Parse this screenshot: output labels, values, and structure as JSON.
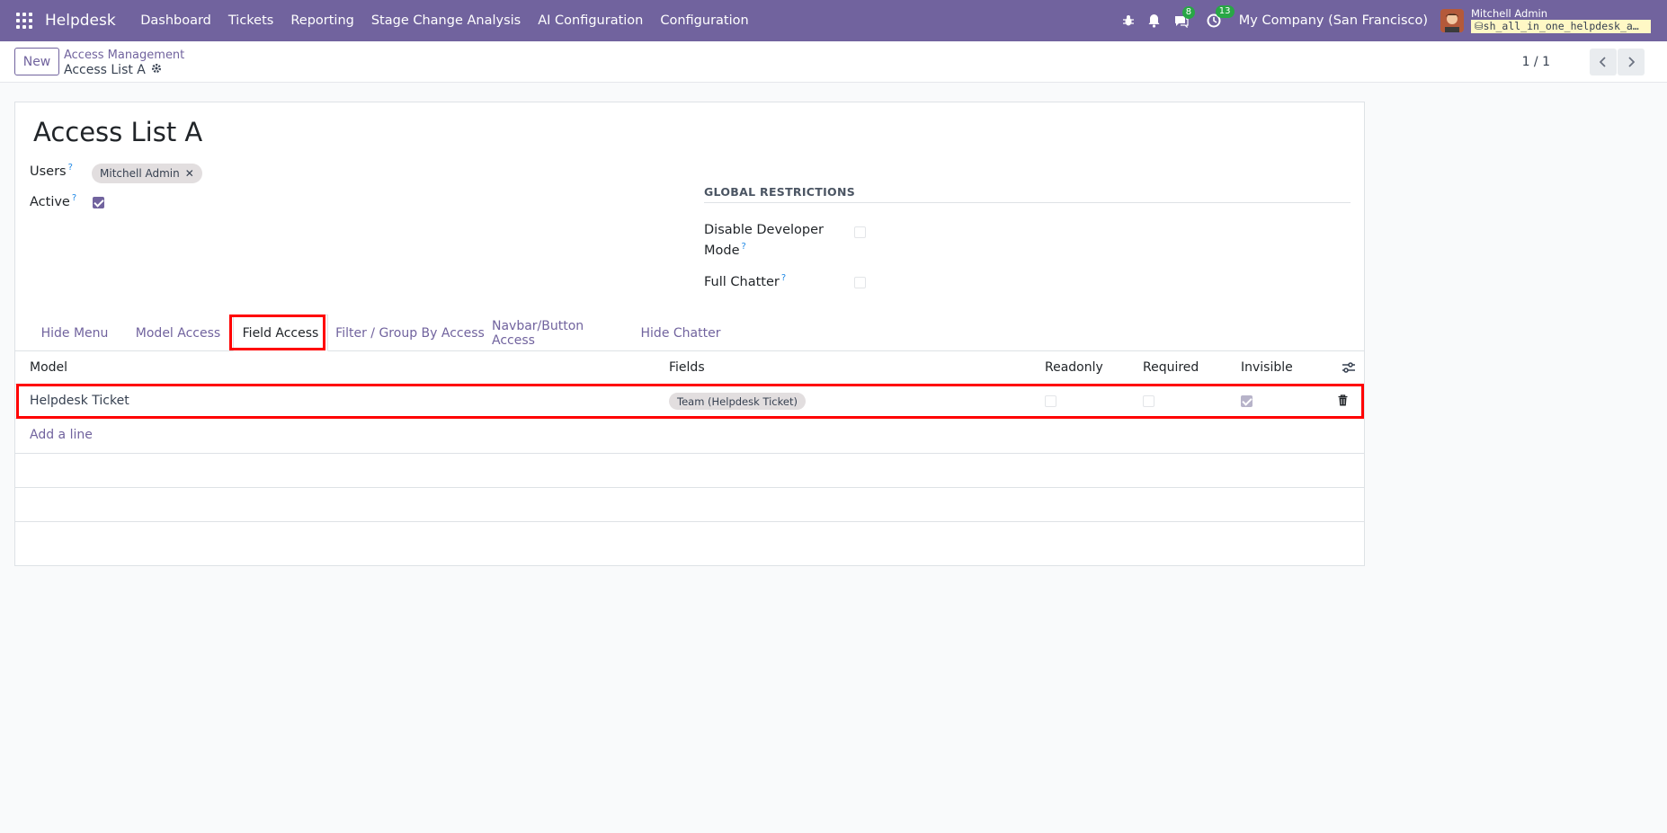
{
  "navbar": {
    "app_name": "Helpdesk",
    "menu": [
      "Dashboard",
      "Tickets",
      "Reporting",
      "Stage Change Analysis",
      "AI Configuration",
      "Configuration"
    ],
    "messages_count": "8",
    "activities_count": "13",
    "company": "My Company (San Francisco)",
    "user_name": "Mitchell Admin",
    "database": "sh_all_in_one_helpdesk_a…"
  },
  "control": {
    "new_label": "New",
    "breadcrumb_parent": "Access Management",
    "breadcrumb_current": "Access List A",
    "pager": "1 / 1"
  },
  "form": {
    "title": "Access List A",
    "users_label": "Users",
    "users_tags": [
      "Mitchell Admin"
    ],
    "active_label": "Active",
    "active_checked": true,
    "global_restrictions_title": "GLOBAL RESTRICTIONS",
    "disable_dev_mode_label_1": "Disable Developer",
    "disable_dev_mode_label_2": "Mode",
    "full_chatter_label": "Full Chatter",
    "help_mark": "?"
  },
  "tabs": [
    "Hide Menu",
    "Model Access",
    "Field Access",
    "Filter / Group By Access",
    "Navbar/Button Access",
    "Hide Chatter"
  ],
  "active_tab": "Field Access",
  "table": {
    "headers": [
      "Model",
      "Fields",
      "Readonly",
      "Required",
      "Invisible"
    ],
    "rows": [
      {
        "model": "Helpdesk Ticket",
        "fields": [
          "Team (Helpdesk Ticket)"
        ],
        "readonly": false,
        "required": false,
        "invisible": true
      }
    ],
    "add_line": "Add a line"
  },
  "colors": {
    "brand": "#71639e",
    "highlight": "#ff0000"
  }
}
